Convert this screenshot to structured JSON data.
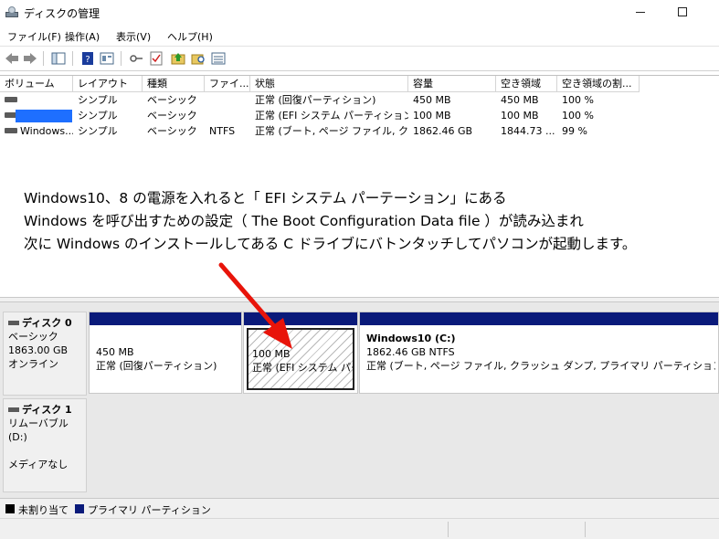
{
  "window": {
    "title": "ディスクの管理",
    "min_glyph": "—",
    "max_glyph": "☐"
  },
  "menu": [
    "ファイル(F)",
    "操作(A)",
    "表示(V)",
    "ヘルプ(H)"
  ],
  "toolbar_icons": [
    "back-arrow-icon",
    "forward-arrow-icon",
    "console-tree-icon",
    "help-icon",
    "properties-icon",
    "key-icon",
    "checklist-icon",
    "folder-up-icon",
    "search-folder-icon",
    "list-view-icon"
  ],
  "volume_table": {
    "columns": [
      "ボリューム",
      "レイアウト",
      "種類",
      "ファイ...",
      "状態",
      "容量",
      "空き領域",
      "空き領域の割..."
    ],
    "rows": [
      {
        "volume": "",
        "layout": "シンプル",
        "type": "ベーシック",
        "fs": "",
        "status": "正常 (回復パーティション)",
        "capacity": "450 MB",
        "free": "450 MB",
        "pct": "100 %"
      },
      {
        "volume": "",
        "layout": "シンプル",
        "type": "ベーシック",
        "fs": "",
        "status": "正常 (EFI システム パーティション)",
        "capacity": "100 MB",
        "free": "100 MB",
        "pct": "100 %"
      },
      {
        "volume": "Windows...",
        "layout": "シンプル",
        "type": "ベーシック",
        "fs": "NTFS",
        "status": "正常 (ブート, ページ ファイル, クラ...",
        "capacity": "1862.46 GB",
        "free": "1844.73 ...",
        "pct": "99 %"
      }
    ]
  },
  "annotation": {
    "line1": "Windows10、8 の電源を入れると「 EFI システム パーテーション」にある",
    "line2": "Windows を呼び出すための設定（ The Boot Configuration Data file ）が読み込まれ",
    "line3": "次に Windows のインストールしてある C ドライブにバトンタッチしてパソコンが起動します。",
    "arrow_color": "#e8140a"
  },
  "disks": [
    {
      "name": "ディスク 0",
      "type": "ベーシック",
      "size": "1863.00 GB",
      "status": "オンライン",
      "partitions": [
        {
          "title": "",
          "size": "450 MB",
          "status": "正常 (回復パーティション)"
        },
        {
          "title": "",
          "size": "100 MB",
          "status": "正常 (EFI システム パーテ"
        },
        {
          "title": "Windows10  (C:)",
          "size": "1862.46 GB NTFS",
          "status": "正常 (ブート, ページ ファイル, クラッシュ ダンプ, プライマリ パーティション)"
        }
      ]
    },
    {
      "name": "ディスク 1",
      "type": "リムーバブル (D:)",
      "size": "",
      "status": "メディアなし"
    }
  ],
  "legend": [
    {
      "label": "未割り当て",
      "color": "#000000"
    },
    {
      "label": "プライマリ パーティション",
      "color": "#0a1a7a"
    }
  ],
  "colors": {
    "primary_partition_bar": "#0a1a7a",
    "selection": "#1e6fff"
  }
}
